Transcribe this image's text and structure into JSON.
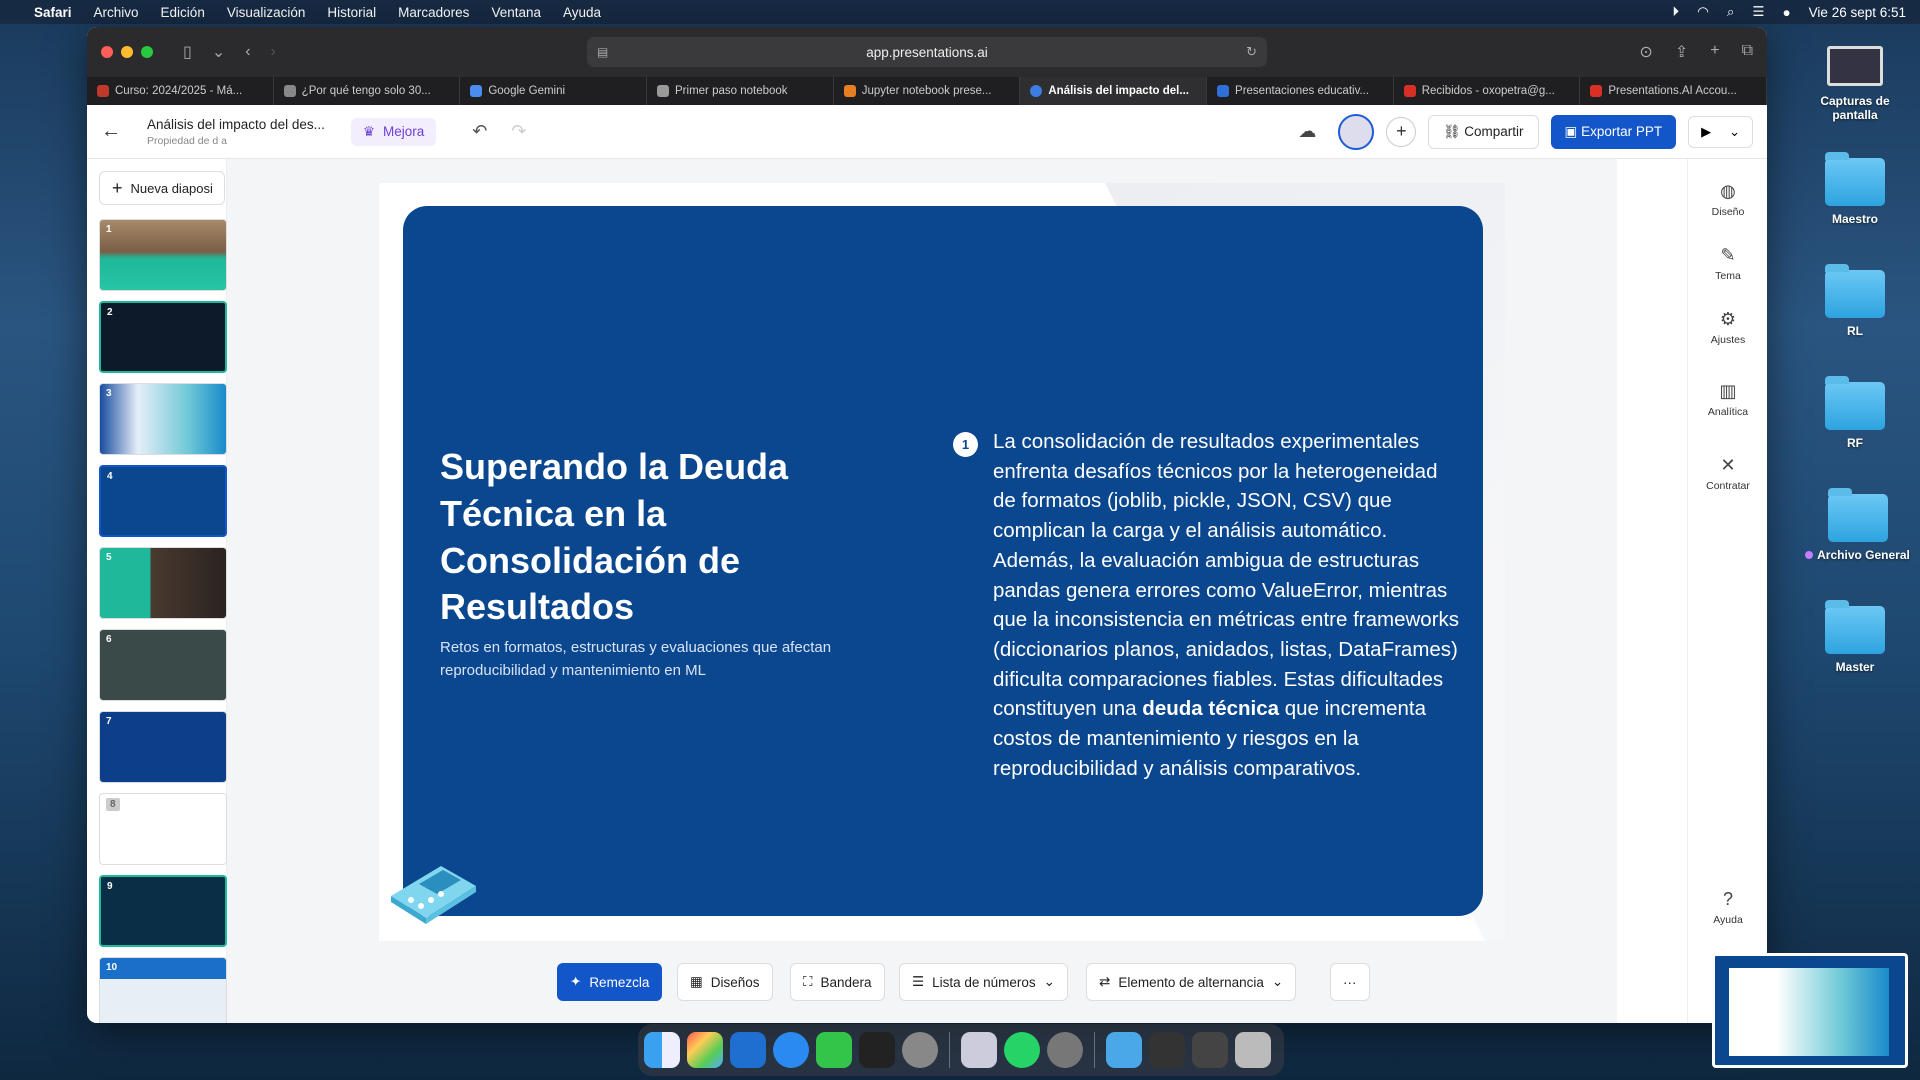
{
  "menubar": {
    "app": "Safari",
    "items": [
      "Archivo",
      "Edición",
      "Visualización",
      "Historial",
      "Marcadores",
      "Ventana",
      "Ayuda"
    ],
    "clock": "Vie 26 sept  6:51"
  },
  "desktop": {
    "icons": [
      {
        "label": "Capturas de pantalla"
      },
      {
        "label": "Maestro"
      },
      {
        "label": "RL"
      },
      {
        "label": "RF"
      },
      {
        "label": "Archivo General"
      },
      {
        "label": "Master"
      }
    ]
  },
  "browser": {
    "url": "app.presentations.ai",
    "tabs": [
      {
        "label": "Curso: 2024/2025 - Má...",
        "color": "#c0392b"
      },
      {
        "label": "¿Por qué tengo solo 30...",
        "color": "#555"
      },
      {
        "label": "Google Gemini",
        "color": "#4a8df0"
      },
      {
        "label": "Primer paso notebook",
        "color": "#777"
      },
      {
        "label": "Jupyter notebook prese...",
        "color": "#e67e22"
      },
      {
        "label": "Análisis del impacto del...",
        "color": "#3b7de0",
        "active": true
      },
      {
        "label": "Presentaciones educativ...",
        "color": "#2e6fd8"
      },
      {
        "label": "Recibidos - oxopetra@g...",
        "color": "#d93025"
      },
      {
        "label": "Presentations.AI Accou...",
        "color": "#d93025"
      }
    ]
  },
  "app": {
    "doc_title": "Análisis del impacto del des...",
    "doc_subtitle": "Propiedad de d a",
    "mejora_label": "Mejora",
    "share_label": "Compartir",
    "export_label": "Exportar PPT",
    "new_slide_label": "Nueva diaposi",
    "slide_numbers": [
      "1",
      "2",
      "3",
      "4",
      "5",
      "6",
      "7",
      "8",
      "9",
      "10"
    ],
    "selected_slide": "4"
  },
  "slide": {
    "title": "Superando la Deuda Técnica en la Consolidación de Resultados",
    "subtitle": "Retos en formatos, estructuras y evaluaciones que afectan reproducibilidad y mantenimiento en ML",
    "point_number": "1",
    "body_part1": "La consolidación de resultados experimentales enfrenta desafíos técnicos por la heterogeneidad de formatos (joblib, pickle, JSON, CSV) que complican la carga y el análisis automático. Además, la evaluación ambigua de estructuras pandas genera errores como ValueError, mientras que la inconsistencia en métricas entre frameworks (diccionarios planos, anidados, listas, DataFrames) dificulta comparaciones fiables. Estas dificultades constituyen una ",
    "body_bold": "deuda técnica",
    "body_part2": " que incrementa costos de mantenimiento y riesgos en la reproducibilidad y análisis comparativos."
  },
  "rail": {
    "diseno": "Diseño",
    "tema": "Tema",
    "ajustes": "Ajustes",
    "analitica": "Analítica",
    "contratar": "Contratar",
    "ayuda": "Ayuda"
  },
  "toolbar": {
    "remezcla": "Remezcla",
    "disenos": "Diseños",
    "bandera": "Bandera",
    "lista": "Lista de números",
    "alternancia": "Elemento de alternancia",
    "more": "···"
  }
}
